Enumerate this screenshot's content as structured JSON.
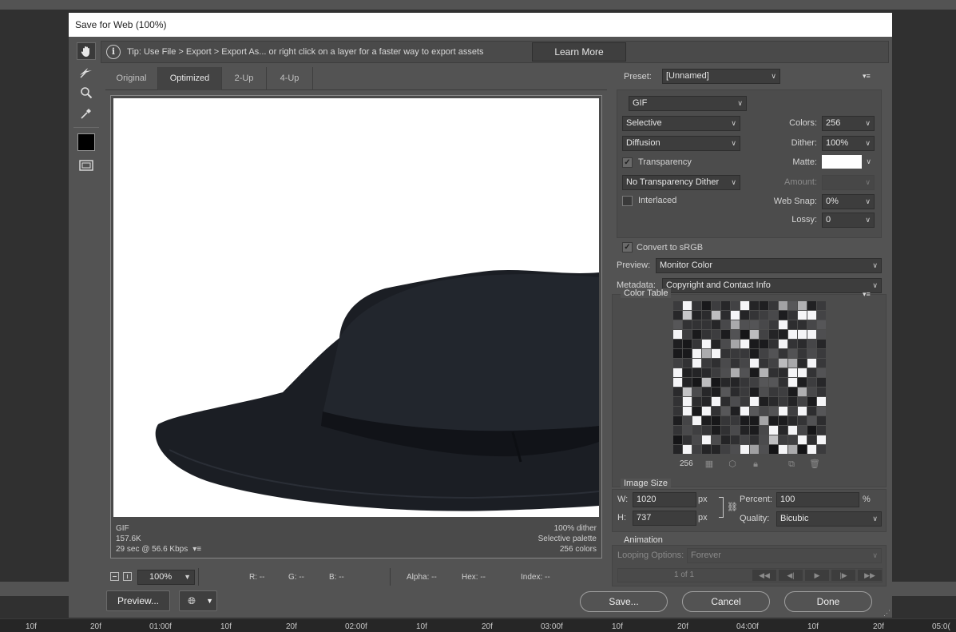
{
  "dialog": {
    "title": "Save for Web (100%)"
  },
  "tip": {
    "text": "Tip: Use File > Export > Export As...  or right click on a layer for a faster way to export assets",
    "learn_more": "Learn More"
  },
  "tabs": [
    {
      "label": "Original"
    },
    {
      "label": "Optimized"
    },
    {
      "label": "2-Up"
    },
    {
      "label": "4-Up"
    }
  ],
  "active_tab": "Optimized",
  "preview_info": {
    "format": "GIF",
    "size": "157.6K",
    "time": "29 sec @ 56.6 Kbps",
    "dither": "100% dither",
    "palette": "Selective palette",
    "colors": "256 colors"
  },
  "status": {
    "zoom": "100%",
    "r": "R: --",
    "g": "G: --",
    "b": "B: --",
    "alpha": "Alpha: --",
    "hex": "Hex: --",
    "index": "Index: --"
  },
  "buttons": {
    "preview": "Preview...",
    "save": "Save...",
    "cancel": "Cancel",
    "done": "Done"
  },
  "settings": {
    "preset_label": "Preset:",
    "preset": "[Unnamed]",
    "format": "GIF",
    "reduction": "Selective",
    "dither_algo": "Diffusion",
    "transparency_label": "Transparency",
    "transparency_checked": true,
    "transparency_dither": "No Transparency Dither",
    "interlaced_label": "Interlaced",
    "interlaced_checked": false,
    "colors_label": "Colors:",
    "colors": "256",
    "dither_label": "Dither:",
    "dither": "100%",
    "matte_label": "Matte:",
    "matte_color": "#ffffff",
    "amount_label": "Amount:",
    "websnap_label": "Web Snap:",
    "websnap": "0%",
    "lossy_label": "Lossy:",
    "lossy": "0",
    "srgb_label": "Convert to sRGB",
    "srgb_checked": true,
    "preview_label": "Preview:",
    "preview_mode": "Monitor Color",
    "metadata_label": "Metadata:",
    "metadata": "Copyright and Contact Info"
  },
  "color_table": {
    "title": "Color Table",
    "count": "256"
  },
  "image_size": {
    "title": "Image Size",
    "w_label": "W:",
    "w": "1020",
    "h_label": "H:",
    "h": "737",
    "unit": "px",
    "percent_label": "Percent:",
    "percent": "100",
    "percent_unit": "%",
    "quality_label": "Quality:",
    "quality": "Bicubic"
  },
  "animation": {
    "title": "Animation",
    "looping_label": "Looping Options:",
    "looping": "Forever",
    "frame": "1 of 1"
  },
  "timeline": [
    "10f",
    "20f",
    "01:00f",
    "10f",
    "20f",
    "02:00f",
    "10f",
    "20f",
    "03:00f",
    "10f",
    "20f",
    "04:00f",
    "10f",
    "20f",
    "05:0("
  ],
  "colors": {
    "dialog_bg": "#535353",
    "panel_bg": "#4c4c4c",
    "field_bg": "#3d3d3d"
  }
}
